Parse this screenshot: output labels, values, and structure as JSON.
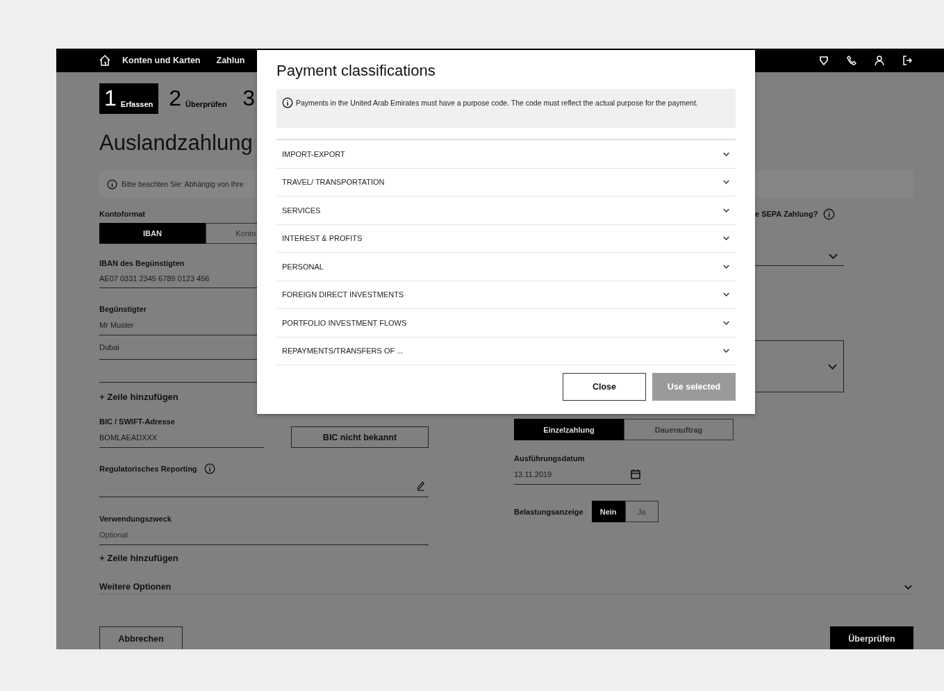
{
  "nav": {
    "items": [
      {
        "label": "Konten und Karten"
      },
      {
        "label": "Zahlun"
      }
    ]
  },
  "steps": [
    {
      "number": "1",
      "label": "Erfassen",
      "selected": true
    },
    {
      "number": "2",
      "label": "Überprüfen",
      "selected": false
    },
    {
      "number": "3",
      "selected": false
    }
  ],
  "title": "Auslandzahlung",
  "notice": "Bitte beachten Sie: Abhängig von Ihre",
  "left": {
    "account_format": {
      "label": "Kontoformat",
      "options": [
        {
          "label": "IBAN",
          "selected": true
        },
        {
          "label": "Konto",
          "selected": false
        }
      ]
    },
    "iban": {
      "label": "IBAN des Begünstigten",
      "value": "AE07 0331 2345 6789 0123 456"
    },
    "beneficiary": {
      "label": "Begünstigter",
      "lines": [
        "Mr Muster",
        "Dubai"
      ]
    },
    "add_line": "+ Zeile hinzufügen",
    "bic": {
      "label": "BIC / SWIFT-Adresse",
      "value": "BOMLAEADXXX",
      "button": "BIC nicht bekannt"
    },
    "regulatory": {
      "label": "Regulatorisches Reporting"
    },
    "purpose": {
      "label": "Verwendungszweck",
      "placeholder": "Optional"
    },
    "add_line_2": "+ Zeile hinzufügen"
  },
  "right": {
    "sepa_question": "e SEPA Zahlung?",
    "payment_type": {
      "options": [
        {
          "label": "Einzelzahlung",
          "selected": true
        },
        {
          "label": "Dauerauftrag",
          "selected": false
        }
      ]
    },
    "execution_date": {
      "label": "Ausführungsdatum",
      "value": "13.11.2019"
    },
    "debit_notice": {
      "label": "Belastungsanzeige",
      "options": [
        {
          "label": "Nein",
          "selected": true
        },
        {
          "label": "Ja",
          "selected": false
        }
      ]
    }
  },
  "more_options": {
    "label": "Weitere Optionen",
    "expanded": false
  },
  "buttons": {
    "cancel": "Abbrechen",
    "review": "Überprüfen"
  },
  "modal": {
    "title": "Payment classifications",
    "info": "Payments in the United Arab Emirates must have a purpose code. The code must reflect the actual purpose for the payment.",
    "categories": [
      {
        "label": "IMPORT-EXPORT",
        "expanded": false
      },
      {
        "label": "TRAVEL/ TRANSPORTATION",
        "expanded": false
      },
      {
        "label": "SERVICES",
        "expanded": false
      },
      {
        "label": "INTEREST & PROFITS",
        "expanded": false
      },
      {
        "label": "PERSONAL",
        "expanded": false
      },
      {
        "label": "FOREIGN DIRECT INVESTMENTS",
        "expanded": false
      },
      {
        "label": "PORTFOLIO INVESTMENT FLOWS",
        "expanded": false
      },
      {
        "label": "REPAYMENTS/TRANSFERS OF ...",
        "expanded": false
      }
    ],
    "buttons": [
      {
        "label": "Close",
        "disabled": false
      },
      {
        "label": "Use selected",
        "disabled": true
      }
    ]
  }
}
